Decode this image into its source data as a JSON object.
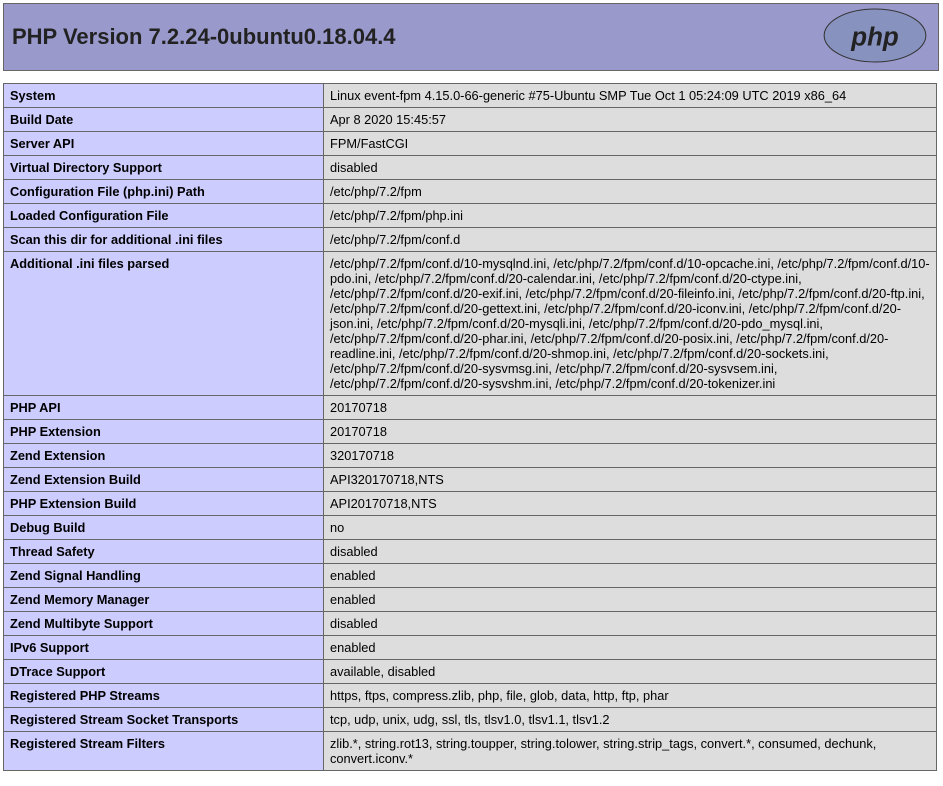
{
  "header": {
    "title": "PHP Version 7.2.24-0ubuntu0.18.04.4"
  },
  "info": [
    {
      "key": "System",
      "val": "Linux event-fpm 4.15.0-66-generic #75-Ubuntu SMP Tue Oct 1 05:24:09 UTC 2019 x86_64"
    },
    {
      "key": "Build Date",
      "val": "Apr 8 2020 15:45:57"
    },
    {
      "key": "Server API",
      "val": "FPM/FastCGI"
    },
    {
      "key": "Virtual Directory Support",
      "val": "disabled"
    },
    {
      "key": "Configuration File (php.ini) Path",
      "val": "/etc/php/7.2/fpm"
    },
    {
      "key": "Loaded Configuration File",
      "val": "/etc/php/7.2/fpm/php.ini"
    },
    {
      "key": "Scan this dir for additional .ini files",
      "val": "/etc/php/7.2/fpm/conf.d"
    },
    {
      "key": "Additional .ini files parsed",
      "val": "/etc/php/7.2/fpm/conf.d/10-mysqlnd.ini, /etc/php/7.2/fpm/conf.d/10-opcache.ini, /etc/php/7.2/fpm/conf.d/10-pdo.ini, /etc/php/7.2/fpm/conf.d/20-calendar.ini, /etc/php/7.2/fpm/conf.d/20-ctype.ini, /etc/php/7.2/fpm/conf.d/20-exif.ini, /etc/php/7.2/fpm/conf.d/20-fileinfo.ini, /etc/php/7.2/fpm/conf.d/20-ftp.ini, /etc/php/7.2/fpm/conf.d/20-gettext.ini, /etc/php/7.2/fpm/conf.d/20-iconv.ini, /etc/php/7.2/fpm/conf.d/20-json.ini, /etc/php/7.2/fpm/conf.d/20-mysqli.ini, /etc/php/7.2/fpm/conf.d/20-pdo_mysql.ini, /etc/php/7.2/fpm/conf.d/20-phar.ini, /etc/php/7.2/fpm/conf.d/20-posix.ini, /etc/php/7.2/fpm/conf.d/20-readline.ini, /etc/php/7.2/fpm/conf.d/20-shmop.ini, /etc/php/7.2/fpm/conf.d/20-sockets.ini, /etc/php/7.2/fpm/conf.d/20-sysvmsg.ini, /etc/php/7.2/fpm/conf.d/20-sysvsem.ini, /etc/php/7.2/fpm/conf.d/20-sysvshm.ini, /etc/php/7.2/fpm/conf.d/20-tokenizer.ini"
    },
    {
      "key": "PHP API",
      "val": "20170718"
    },
    {
      "key": "PHP Extension",
      "val": "20170718"
    },
    {
      "key": "Zend Extension",
      "val": "320170718"
    },
    {
      "key": "Zend Extension Build",
      "val": "API320170718,NTS"
    },
    {
      "key": "PHP Extension Build",
      "val": "API20170718,NTS"
    },
    {
      "key": "Debug Build",
      "val": "no"
    },
    {
      "key": "Thread Safety",
      "val": "disabled"
    },
    {
      "key": "Zend Signal Handling",
      "val": "enabled"
    },
    {
      "key": "Zend Memory Manager",
      "val": "enabled"
    },
    {
      "key": "Zend Multibyte Support",
      "val": "disabled"
    },
    {
      "key": "IPv6 Support",
      "val": "enabled"
    },
    {
      "key": "DTrace Support",
      "val": "available, disabled"
    },
    {
      "key": "Registered PHP Streams",
      "val": "https, ftps, compress.zlib, php, file, glob, data, http, ftp, phar"
    },
    {
      "key": "Registered Stream Socket Transports",
      "val": "tcp, udp, unix, udg, ssl, tls, tlsv1.0, tlsv1.1, tlsv1.2"
    },
    {
      "key": "Registered Stream Filters",
      "val": "zlib.*, string.rot13, string.toupper, string.tolower, string.strip_tags, convert.*, consumed, dechunk, convert.iconv.*"
    }
  ]
}
